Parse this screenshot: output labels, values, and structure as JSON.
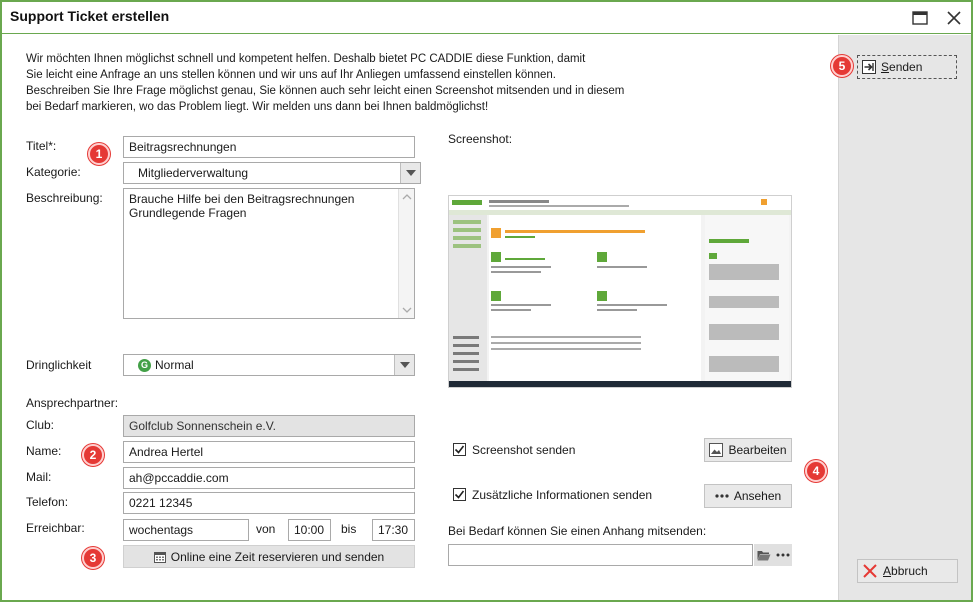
{
  "window": {
    "title": "Support Ticket erstellen"
  },
  "intro": {
    "lines": [
      "Wir möchten Ihnen möglichst schnell und kompetent helfen. Deshalb bietet PC CADDIE diese Funktion, damit",
      "Sie leicht eine Anfrage an uns stellen können und wir uns auf Ihr Anliegen umfassend einstellen können.",
      "Beschreiben Sie Ihre Frage möglichst genau, Sie können auch sehr leicht einen Screenshot mitsenden und in diesem",
      "bei Bedarf markieren, wo das Problem liegt. Wir melden uns dann bei Ihnen baldmöglichst!"
    ]
  },
  "form": {
    "title_label": "Titel*:",
    "title_value": "Beitragsrechnungen",
    "category_label": "Kategorie:",
    "category_value": "Mitgliederverwaltung",
    "description_label": "Beschreibung:",
    "description_lines": [
      "Brauche Hilfe bei den Beitragsrechnungen",
      "Grundlegende Fragen"
    ],
    "urgency_label": "Dringlichkeit",
    "urgency_badge": "G",
    "urgency_value": "Normal",
    "contact_label": "Ansprechpartner:",
    "club_label": "Club:",
    "club_value": "Golfclub Sonnenschein e.V.",
    "name_label": "Name:",
    "name_value": "Andrea Hertel",
    "mail_label": "Mail:",
    "mail_value": "ah@pccaddie.com",
    "phone_label": "Telefon:",
    "phone_value": "0221 12345",
    "reachable_label": "Erreichbar:",
    "reachable_value": "wochentags",
    "from_label": "von",
    "from_value": "10:00",
    "to_label": "bis",
    "to_value": "17:30",
    "reserve_button": "Online eine Zeit reservieren und senden"
  },
  "screenshot": {
    "label": "Screenshot:",
    "send_label": "Screenshot senden",
    "send_checked": true,
    "edit_button": "Bearbeiten",
    "extra_info_label": "Zusätzliche Informationen senden",
    "extra_info_checked": true,
    "view_button": "Ansehen",
    "attachment_label": "Bei Bedarf können Sie einen Anhang mitsenden:",
    "attachment_value": ""
  },
  "actions": {
    "send_prefix": "",
    "send_underline": "S",
    "send_rest": "enden",
    "cancel_underline": "A",
    "cancel_rest": "bbruch"
  },
  "badges": [
    "1",
    "2",
    "3",
    "4",
    "5"
  ],
  "colors": {
    "window_border": "#6aa84f",
    "badge": "#e53935",
    "right_pane": "#e6e6e6",
    "urgency_green": "#43a047"
  }
}
